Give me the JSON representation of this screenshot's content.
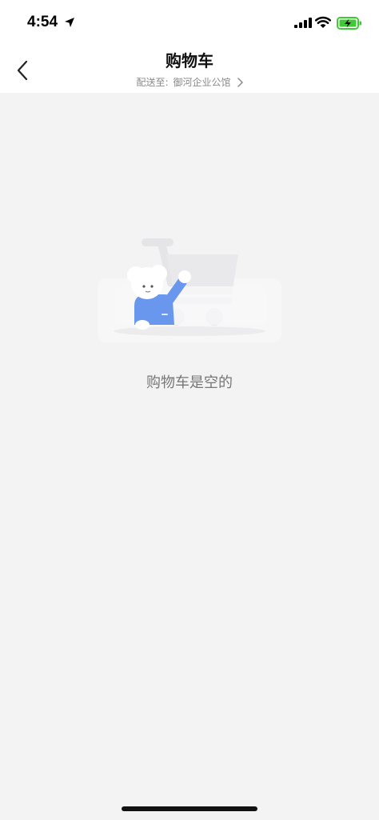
{
  "status_bar": {
    "time": "4:54"
  },
  "nav": {
    "title": "购物车",
    "delivery_prefix": "配送至:",
    "delivery_location": "御河企业公馆"
  },
  "empty_state": {
    "message": "购物车是空的"
  },
  "colors": {
    "background": "#f3f3f4",
    "header": "#ffffff",
    "battery_green": "#3fc935",
    "mascot_blue": "#6a97ee"
  },
  "icons": {
    "back": "chevron-left-icon",
    "delivery_arrow": "chevron-right-icon",
    "location": "location-arrow-icon",
    "signal": "cellular-signal-icon",
    "wifi": "wifi-icon",
    "battery": "battery-charging-icon"
  }
}
